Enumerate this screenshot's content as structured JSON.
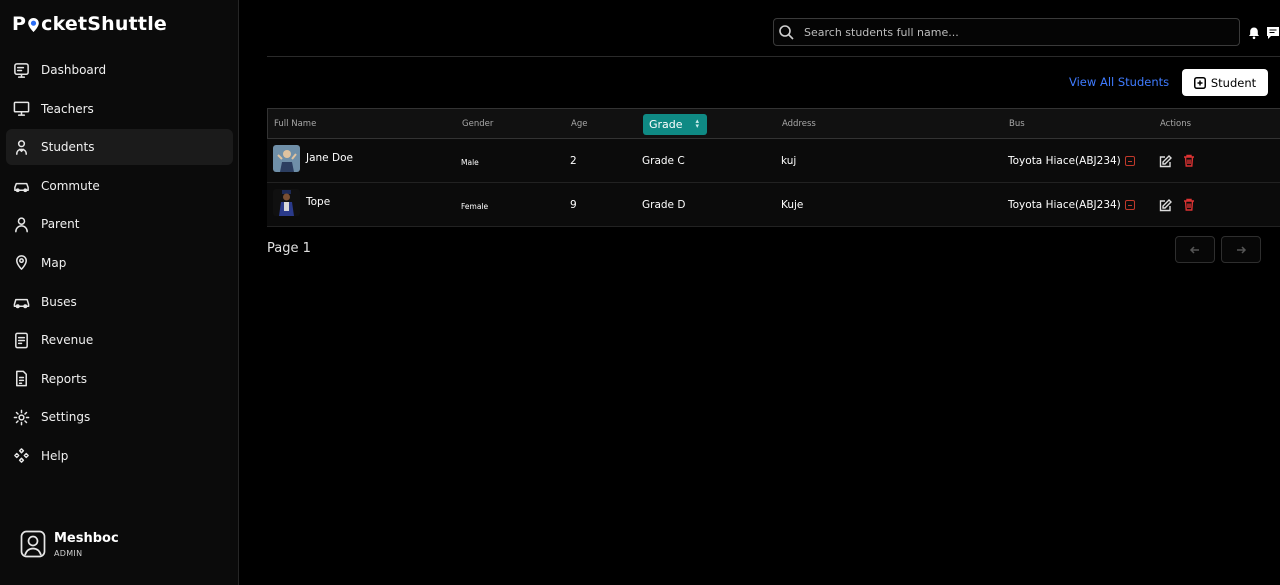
{
  "app": {
    "logo_prefix": "P",
    "logo_suffix": "cketShuttle"
  },
  "sidebar": {
    "items": [
      {
        "label": "Dashboard",
        "icon": "dashboard-icon"
      },
      {
        "label": "Teachers",
        "icon": "monitor-icon"
      },
      {
        "label": "Students",
        "icon": "student-icon",
        "active": true
      },
      {
        "label": "Commute",
        "icon": "car-icon"
      },
      {
        "label": "Parent",
        "icon": "user-icon"
      },
      {
        "label": "Map",
        "icon": "map-pin-icon"
      },
      {
        "label": "Buses",
        "icon": "bus-icon"
      },
      {
        "label": "Revenue",
        "icon": "revenue-icon"
      },
      {
        "label": "Reports",
        "icon": "reports-icon"
      },
      {
        "label": "Settings",
        "icon": "gear-icon"
      },
      {
        "label": "Help",
        "icon": "help-icon"
      }
    ],
    "user": {
      "name": "Meshboc",
      "role": "ADMIN"
    }
  },
  "header": {
    "search_placeholder": "Search students full name...",
    "view_all_label": "View All Students",
    "add_button_label": "Student"
  },
  "table": {
    "columns": {
      "full_name": "Full Name",
      "gender": "Gender",
      "age": "Age",
      "grade": "Grade",
      "address": "Address",
      "bus": "Bus",
      "actions": "Actions"
    },
    "rows": [
      {
        "name": "Jane Doe",
        "gender": "Male",
        "age": "2",
        "grade": "Grade C",
        "address": "kuj",
        "bus": "Toyota Hiace(ABJ234)"
      },
      {
        "name": "Tope",
        "gender": "Female",
        "age": "9",
        "grade": "Grade D",
        "address": "Kuje",
        "bus": "Toyota Hiace(ABJ234)"
      }
    ]
  },
  "pagination": {
    "label": "Page 1"
  },
  "colors": {
    "accent": "#0f8a84",
    "link": "#3f7bff",
    "danger": "#d33333"
  }
}
